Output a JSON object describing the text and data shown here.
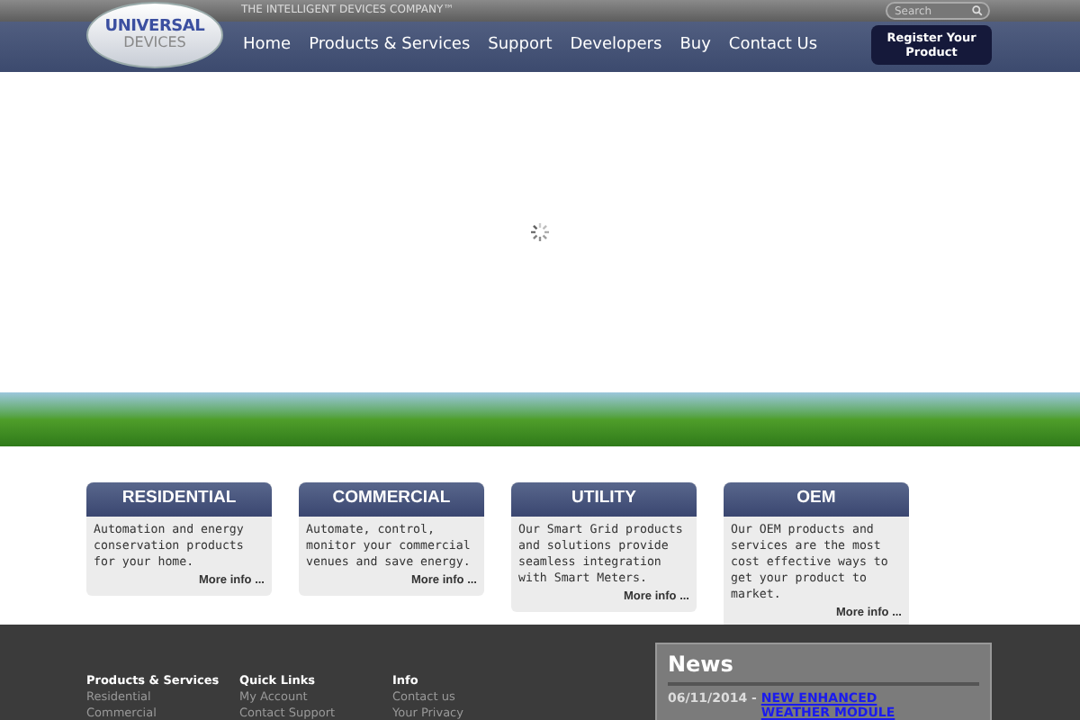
{
  "header": {
    "logo": {
      "line_1": "UNIVERSAL",
      "line_2": "DEVICES"
    },
    "tagline": "THE INTELLIGENT DEVICES COMPANY™",
    "search": {
      "placeholder": "Search"
    },
    "nav": [
      "Home",
      "Products & Services",
      "Support",
      "Developers",
      "Buy",
      "Contact Us"
    ],
    "register_button": "Register Your Product"
  },
  "cards": [
    {
      "title": "RESIDENTIAL",
      "text": "Automation and energy conservation products for your home.",
      "link": "More info ..."
    },
    {
      "title": "COMMERCIAL",
      "text": "Automate, control, monitor your commercial venues and save energy.",
      "link": "More info ..."
    },
    {
      "title": "UTILITY",
      "text": "Our Smart Grid products and solutions provide seamless integration with Smart Meters.",
      "link": "More info ..."
    },
    {
      "title": "OEM",
      "text": "Our OEM products and services are the most cost effective ways to get your product to market.",
      "link": "More info ..."
    }
  ],
  "footer": {
    "columns": [
      {
        "heading": "Products & Services",
        "links": [
          "Residential",
          "Commercial"
        ]
      },
      {
        "heading": "Quick Links",
        "links": [
          "My Account",
          "Contact Support"
        ]
      },
      {
        "heading": "Info",
        "links": [
          "Contact us",
          "Your Privacy"
        ]
      }
    ],
    "news": {
      "title": "News",
      "items": [
        {
          "date": "06/11/2014 - ",
          "headline": "NEW ENHANCED WEATHER MODULE"
        }
      ]
    }
  }
}
